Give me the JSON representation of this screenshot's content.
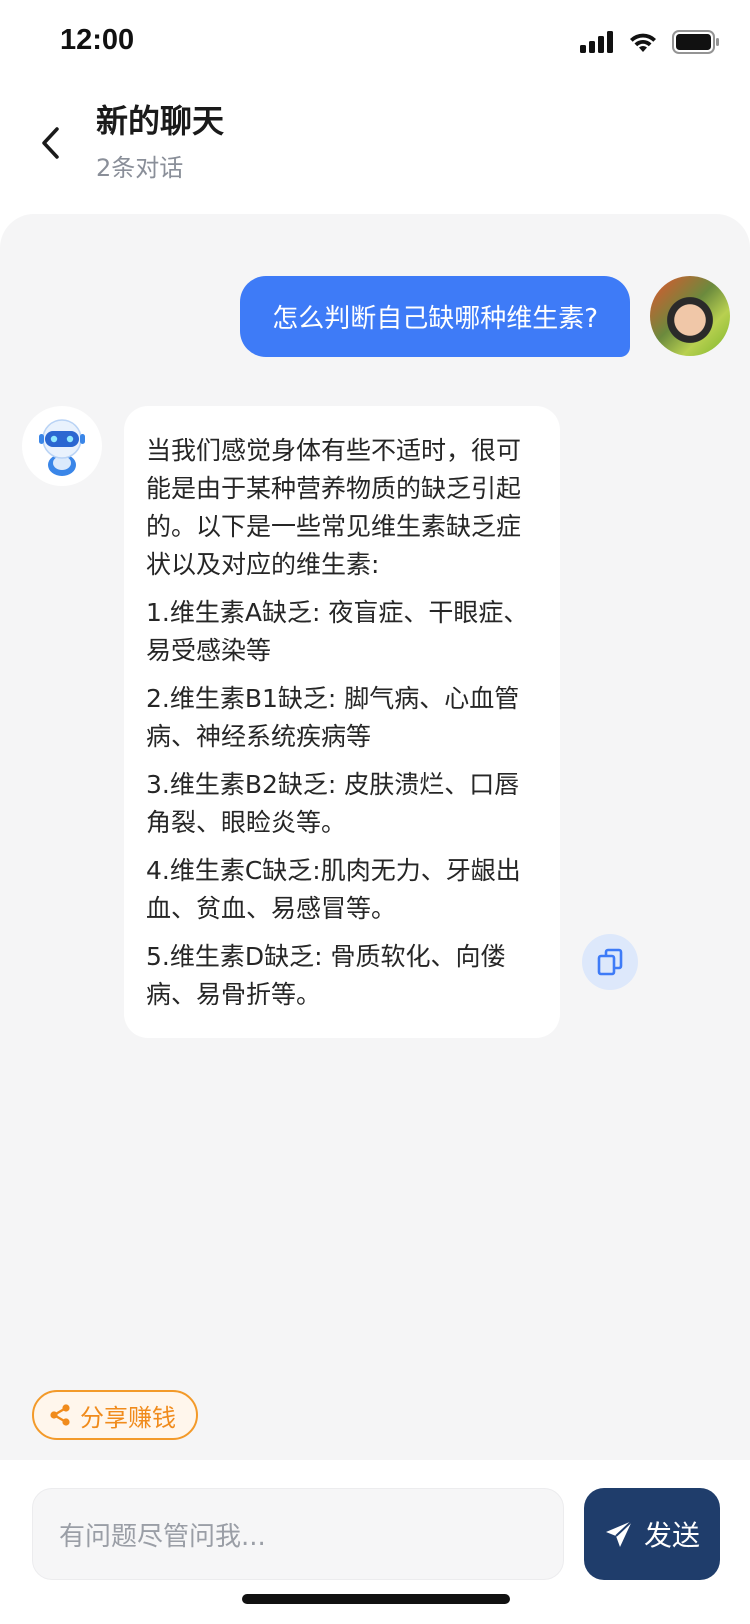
{
  "status_bar": {
    "time": "12:00"
  },
  "header": {
    "back_icon": "chevron-left-icon",
    "title": "新的聊天",
    "subtitle": "2条对话"
  },
  "chat": {
    "user_message": "怎么判断自己缺哪种维生素?",
    "bot_message": {
      "intro": "当我们感觉身体有些不适时，很可能是由于某种营养物质的缺乏引起的。以下是一些常见维生素缺乏症状以及对应的维生素:",
      "items": [
        "1.维生素A缺乏: 夜盲症、干眼症、易受感染等",
        "2.维生素B1缺乏: 脚气病、心血管病、神经系统疾病等",
        "3.维生素B2缺乏: 皮肤溃烂、口唇角裂、眼睑炎等。",
        "4.维生素C缺乏:肌肉无力、牙龈出血、贫血、易感冒等。",
        "5.维生素D缺乏: 骨质软化、向偻病、易骨折等。"
      ]
    }
  },
  "share_button": {
    "label": "分享赚钱",
    "icon": "share-icon",
    "color": "#f08b1c"
  },
  "input": {
    "placeholder": "有问题尽管问我...",
    "send_label": "发送",
    "send_icon": "send-icon"
  },
  "colors": {
    "user_bubble": "#3e7bf7",
    "send_button": "#1f3d6b",
    "chat_background": "#f5f5f6"
  }
}
